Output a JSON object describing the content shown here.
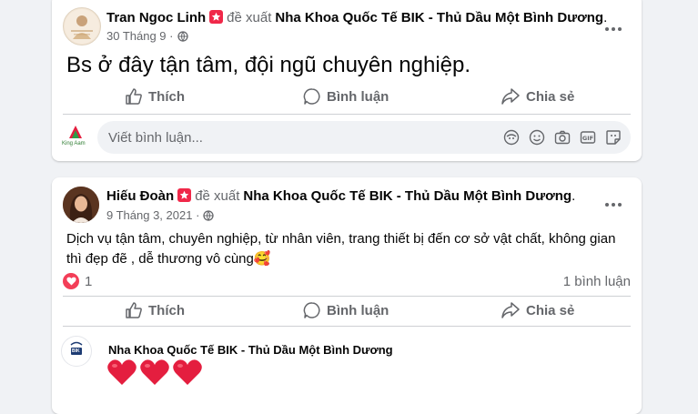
{
  "colors": {
    "accent": "#1877f2",
    "secondary_text": "#65676b",
    "heart": "#e41e3f",
    "badge": "#f02849"
  },
  "posts": [
    {
      "author": "Tran Ngoc Linh",
      "verb": "đề xuất",
      "page": "Nha Khoa Quốc Tế BIK - Thủ Dầu Một Bình Dương",
      "period": ".",
      "date": "30 Tháng 9",
      "sep": "·",
      "privacy_icon": "globe-icon",
      "text": "Bs ở đây tận tâm, đội ngũ chuyên nghiệp.",
      "actions": {
        "like": "Thích",
        "comment": "Bình luận",
        "share": "Chia sẻ"
      },
      "comment_placeholder": "Viết bình luận...",
      "comment_avatar_text": "King Aam",
      "comment_icons": [
        "avatar-sticker-icon",
        "emoji-icon",
        "camera-icon",
        "gif-icon",
        "sticker-icon"
      ]
    },
    {
      "author": "Hiếu Đoàn",
      "verb": "đề xuất",
      "page": "Nha Khoa Quốc Tế BIK - Thủ Dầu Một Bình Dương",
      "period": ".",
      "date": "9 Tháng 3, 2021",
      "sep": "·",
      "privacy_icon": "globe-icon",
      "text": "Dịch vụ tận tâm, chuyên nghiệp, từ nhân viên, trang thiết bị đến cơ sở vật chất, không gian thì đẹp đẽ , dễ thương vô cùng🥰",
      "reaction_count": "1",
      "comment_count": "1 bình luận",
      "actions": {
        "like": "Thích",
        "comment": "Bình luận",
        "share": "Chia sẻ"
      },
      "reply": {
        "author": "Nha Khoa Quốc Tế BIK - Thủ Dầu Một Bình Dương",
        "avatar_text": "BIK",
        "content": "❤❤❤"
      }
    }
  ]
}
